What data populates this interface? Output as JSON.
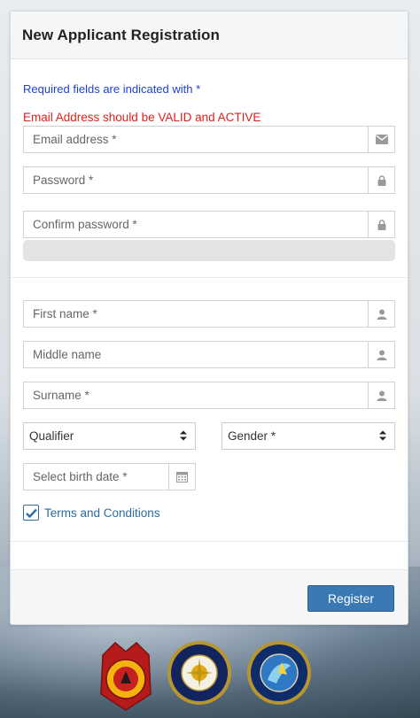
{
  "panel": {
    "title": "New Applicant Registration"
  },
  "notes": {
    "required": "Required fields are indicated with *",
    "email_warning": "Email Address should be VALID and ACTIVE"
  },
  "fields": {
    "email_placeholder": "Email address *",
    "password_placeholder": "Password *",
    "confirm_password_placeholder": "Confirm password *",
    "first_name_placeholder": "First name *",
    "middle_name_placeholder": "Middle name",
    "surname_placeholder": "Surname *",
    "qualifier_selected": "Qualifier",
    "gender_selected": "Gender *",
    "birth_date_placeholder": "Select birth date *"
  },
  "terms": {
    "label": "Terms and Conditions",
    "checked": true
  },
  "footer": {
    "register_label": "Register"
  },
  "colors": {
    "required_note": "#1f3fd6",
    "email_warning": "#e0201a",
    "link": "#2e6b9d",
    "primary_button": "#3b79b5"
  },
  "icons": {
    "email": "envelope-icon",
    "password": "lock-icon",
    "name": "user-icon",
    "select": "sort-caret-icon",
    "date": "calendar-icon",
    "terms": "checkmark-icon"
  },
  "logos": [
    "pnp-seal-logo",
    "dimsm-seal-logo",
    "itms-seal-logo"
  ]
}
